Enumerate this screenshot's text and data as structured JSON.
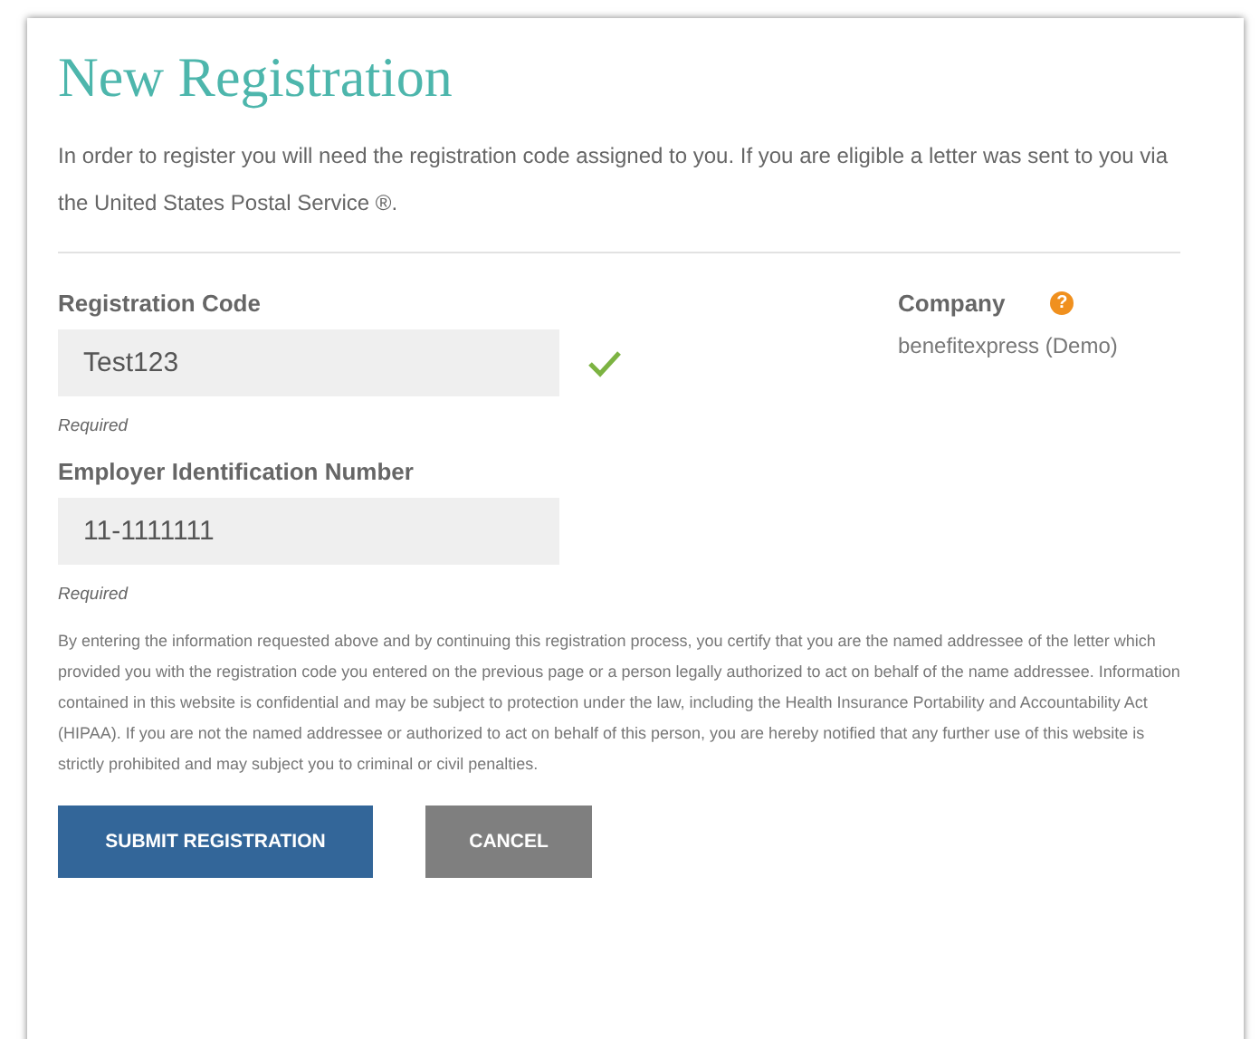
{
  "title": "New Registration",
  "intro": "In order to register you will need the registration code assigned to you. If you are eligible a letter was sent to you via the United States Postal Service ®.",
  "fields": [
    {
      "label": "Registration Code",
      "value": "Test123",
      "valid": true,
      "hint": "Required"
    },
    {
      "label": "Employer Identification Number",
      "value": "11-1111111",
      "valid": false,
      "hint": "Required"
    }
  ],
  "company": {
    "label": "Company",
    "help_icon": "?",
    "value": "benefitexpress (Demo)"
  },
  "disclaimer": "By entering the information requested above and by continuing this registration process, you certify that you are the named addressee of the letter which provided you with the registration code you entered on the previous page or a person legally authorized to act on behalf of the name addressee. Information contained in this website is confidential and may be subject to protection under the law, including the Health Insurance Portability and Accountability Act (HIPAA). If you are not the named addressee or authorized to act on behalf of this person, you are hereby notified that any further use of this website is strictly prohibited and may subject you to criminal or civil penalties.",
  "buttons": [
    {
      "label": "SUBMIT REGISTRATION",
      "kind": "primary"
    },
    {
      "label": "CANCEL",
      "kind": "secondary"
    }
  ]
}
